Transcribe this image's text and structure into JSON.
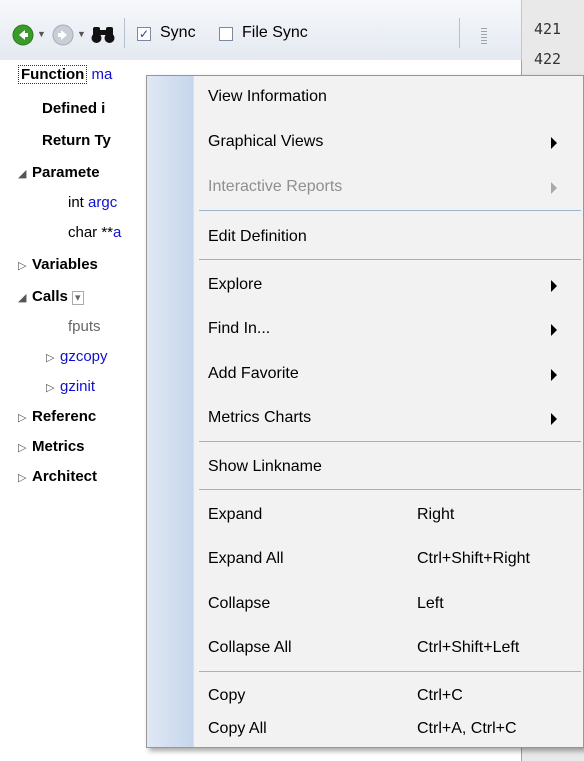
{
  "toolbar": {
    "sync_label": "Sync",
    "sync_checked": true,
    "file_sync_label": "File Sync",
    "file_sync_checked": false,
    "icons": [
      "back-arrow-icon",
      "forward-arrow-icon",
      "binoculars-icon"
    ]
  },
  "code_lines": [
    "421",
    "422"
  ],
  "tree": {
    "function_label": "Function",
    "function_name": "ma",
    "defined_label": "Defined i",
    "return_label": "Return Ty",
    "parameters_label": "Paramete",
    "params": [
      {
        "type": "int",
        "name": "argc"
      },
      {
        "type": "char **",
        "name": "a"
      }
    ],
    "variables_label": "Variables",
    "calls_label": "Calls",
    "calls": [
      {
        "text": "fputs"
      },
      {
        "text": "gzcopy"
      },
      {
        "text": "gzinit"
      }
    ],
    "references_label": "Referenc",
    "metrics_label": "Metrics",
    "architecture_label": "Architect"
  },
  "menu": {
    "items": [
      {
        "label": "View Information",
        "shortcut": "",
        "submenu": false,
        "disabled": false
      },
      {
        "label": "Graphical Views",
        "shortcut": "",
        "submenu": true,
        "disabled": false
      },
      {
        "label": "Interactive Reports",
        "shortcut": "",
        "submenu": true,
        "disabled": true
      },
      {
        "label": "Edit Definition",
        "shortcut": "",
        "submenu": false,
        "disabled": false
      },
      {
        "label": "Explore",
        "shortcut": "",
        "submenu": true,
        "disabled": false
      },
      {
        "label": "Find In...",
        "shortcut": "",
        "submenu": true,
        "disabled": false
      },
      {
        "label": "Add Favorite",
        "shortcut": "",
        "submenu": true,
        "disabled": false
      },
      {
        "label": "Metrics Charts",
        "shortcut": "",
        "submenu": true,
        "disabled": false
      },
      {
        "label": "Show Linkname",
        "shortcut": "",
        "submenu": false,
        "disabled": false
      },
      {
        "label": "Expand",
        "shortcut": "Right",
        "submenu": false,
        "disabled": false
      },
      {
        "label": "Expand All",
        "shortcut": "Ctrl+Shift+Right",
        "submenu": false,
        "disabled": false
      },
      {
        "label": "Collapse",
        "shortcut": "Left",
        "submenu": false,
        "disabled": false
      },
      {
        "label": "Collapse All",
        "shortcut": "Ctrl+Shift+Left",
        "submenu": false,
        "disabled": false
      },
      {
        "label": "Copy",
        "shortcut": "Ctrl+C",
        "submenu": false,
        "disabled": false
      },
      {
        "label": "Copy All",
        "shortcut": "Ctrl+A, Ctrl+C",
        "submenu": false,
        "disabled": false
      }
    ]
  },
  "colors": {
    "accent_green": "#3a9a2a",
    "link_blue": "#1010d0",
    "menu_gutter": "#c6d6ec"
  }
}
